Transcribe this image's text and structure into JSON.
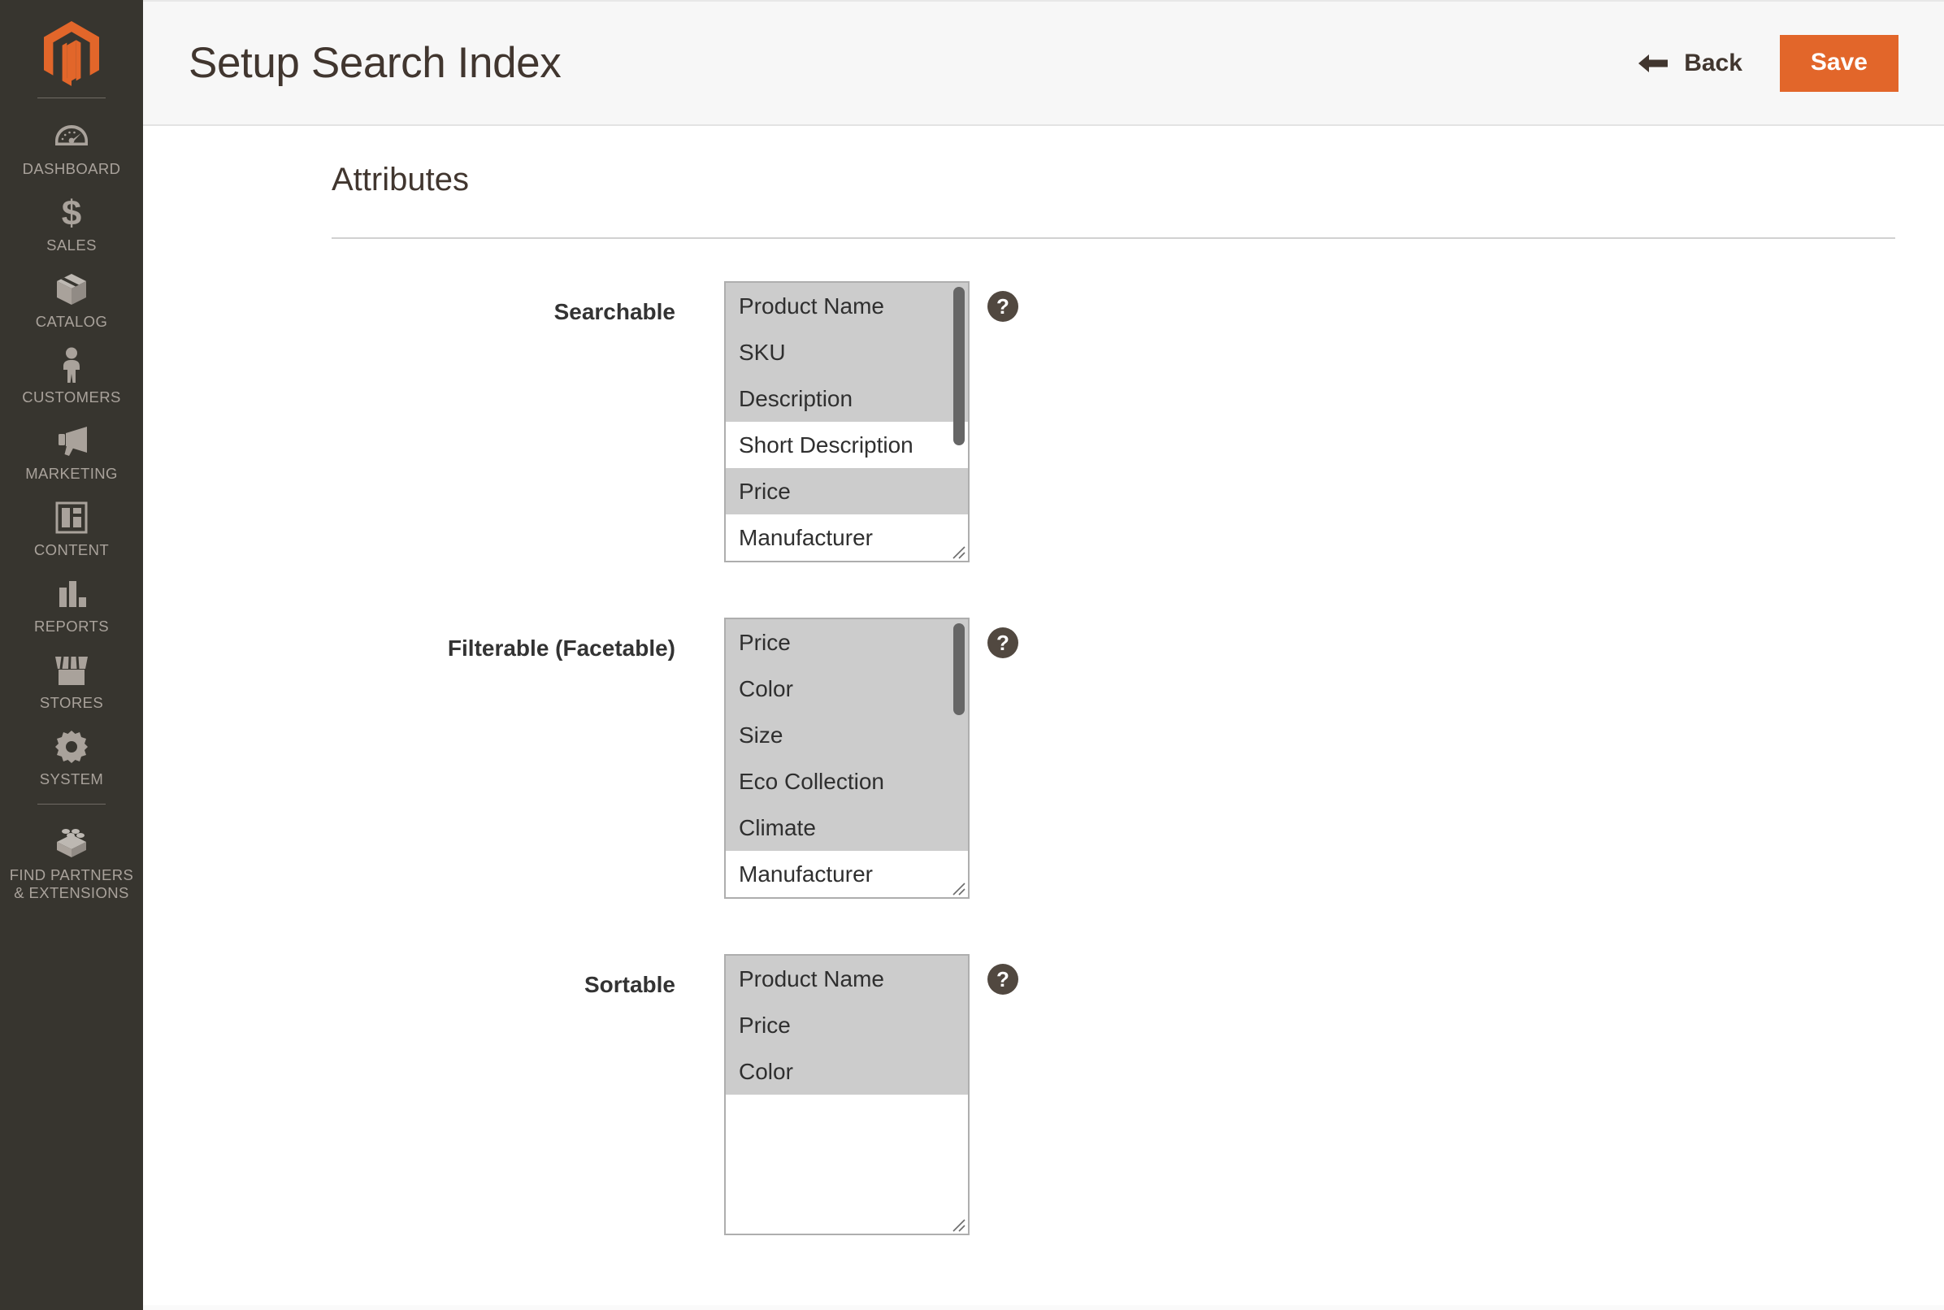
{
  "sidebar": {
    "logo": "magento-logo",
    "items": [
      {
        "label": "DASHBOARD",
        "icon": "dashboard-gauge-icon"
      },
      {
        "label": "SALES",
        "icon": "dollar-sign-icon"
      },
      {
        "label": "CATALOG",
        "icon": "box-icon"
      },
      {
        "label": "CUSTOMERS",
        "icon": "person-icon"
      },
      {
        "label": "MARKETING",
        "icon": "megaphone-icon"
      },
      {
        "label": "CONTENT",
        "icon": "layout-panel-icon"
      },
      {
        "label": "REPORTS",
        "icon": "bar-chart-icon"
      },
      {
        "label": "STORES",
        "icon": "storefront-icon"
      },
      {
        "label": "SYSTEM",
        "icon": "gear-icon"
      },
      {
        "label": "FIND PARTNERS\n& EXTENSIONS",
        "icon": "lego-brick-icon"
      }
    ]
  },
  "header": {
    "title": "Setup Search Index",
    "back_label": "Back",
    "back_icon": "arrow-left-icon",
    "save_label": "Save",
    "save_color": "#e2662a"
  },
  "content": {
    "section_title": "Attributes",
    "help_icon_glyph": "?",
    "fields": [
      {
        "label": "Searchable",
        "name": "searchable",
        "scroll": {
          "visible": true,
          "top_pct": 1.5,
          "height_pct": 57
        },
        "options": [
          {
            "label": "Product Name",
            "selected": true
          },
          {
            "label": "SKU",
            "selected": true
          },
          {
            "label": "Description",
            "selected": true
          },
          {
            "label": "Short Description",
            "selected": false
          },
          {
            "label": "Price",
            "selected": true
          },
          {
            "label": "Manufacturer",
            "selected": false
          }
        ],
        "filler_height": 0
      },
      {
        "label": "Filterable (Facetable)",
        "name": "filterable",
        "scroll": {
          "visible": true,
          "top_pct": 1.5,
          "height_pct": 33
        },
        "options": [
          {
            "label": "Price",
            "selected": true
          },
          {
            "label": "Color",
            "selected": true
          },
          {
            "label": "Size",
            "selected": true
          },
          {
            "label": "Eco Collection",
            "selected": true
          },
          {
            "label": "Climate",
            "selected": true
          },
          {
            "label": "Manufacturer",
            "selected": false
          }
        ],
        "filler_height": 0
      },
      {
        "label": "Sortable",
        "name": "sortable",
        "scroll": {
          "visible": false,
          "top_pct": 0,
          "height_pct": 0
        },
        "options": [
          {
            "label": "Product Name",
            "selected": true
          },
          {
            "label": "Price",
            "selected": true
          },
          {
            "label": "Color",
            "selected": true
          }
        ],
        "filler_height": 171
      }
    ]
  }
}
